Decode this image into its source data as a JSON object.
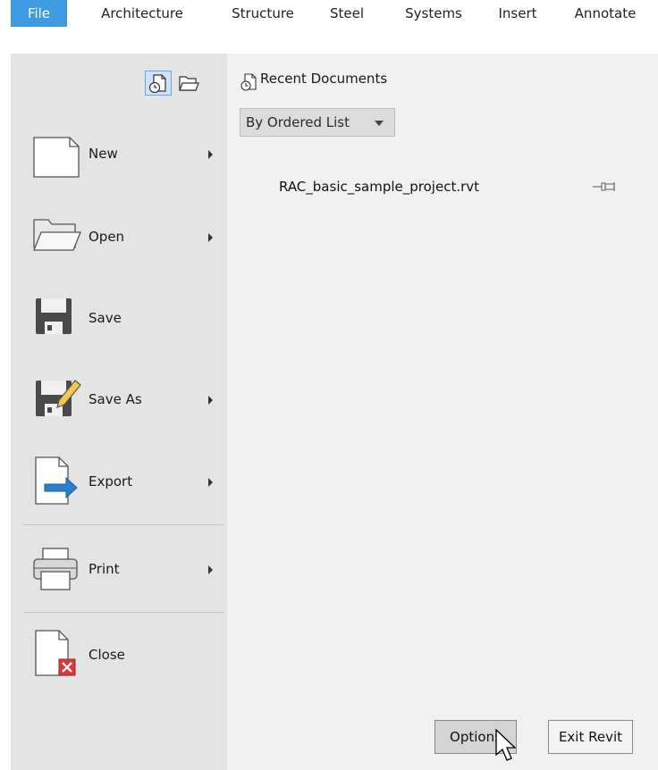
{
  "ribbon": {
    "tabs": [
      {
        "label": "File",
        "active": true
      },
      {
        "label": "Architecture"
      },
      {
        "label": "Structure"
      },
      {
        "label": "Steel"
      },
      {
        "label": "Systems"
      },
      {
        "label": "Insert"
      },
      {
        "label": "Annotate"
      }
    ]
  },
  "app_menu": {
    "view_buttons": [
      {
        "name": "recent-documents-view",
        "icon": "recent-docs-icon",
        "selected": true
      },
      {
        "name": "open-documents-view",
        "icon": "folder-icon",
        "selected": false
      }
    ],
    "items": [
      {
        "label": "New",
        "icon": "new-document-icon",
        "submenu": true
      },
      {
        "label": "Open",
        "icon": "folder-open-icon",
        "submenu": true
      },
      {
        "label": "Save",
        "icon": "floppy-disk-icon",
        "submenu": false
      },
      {
        "label": "Save As",
        "icon": "save-as-icon",
        "submenu": true
      },
      {
        "label": "Export",
        "icon": "export-icon",
        "submenu": true
      },
      {
        "label": "Print",
        "icon": "printer-icon",
        "submenu": true
      },
      {
        "label": "Close",
        "icon": "close-document-icon",
        "submenu": false
      }
    ]
  },
  "recent": {
    "title": "Recent Documents",
    "sort_mode": "By Ordered List",
    "files": [
      {
        "name": "RAC_basic_sample_project.rvt",
        "pinned": false
      }
    ]
  },
  "footer": {
    "options_label": "Options",
    "exit_label": "Exit Revit"
  },
  "colors": {
    "file_tab": "#3f9be0",
    "menu_bg": "#e4e4e4",
    "pane_bg": "#f1f1f1",
    "accent_arrow": "#2a7fd4"
  }
}
